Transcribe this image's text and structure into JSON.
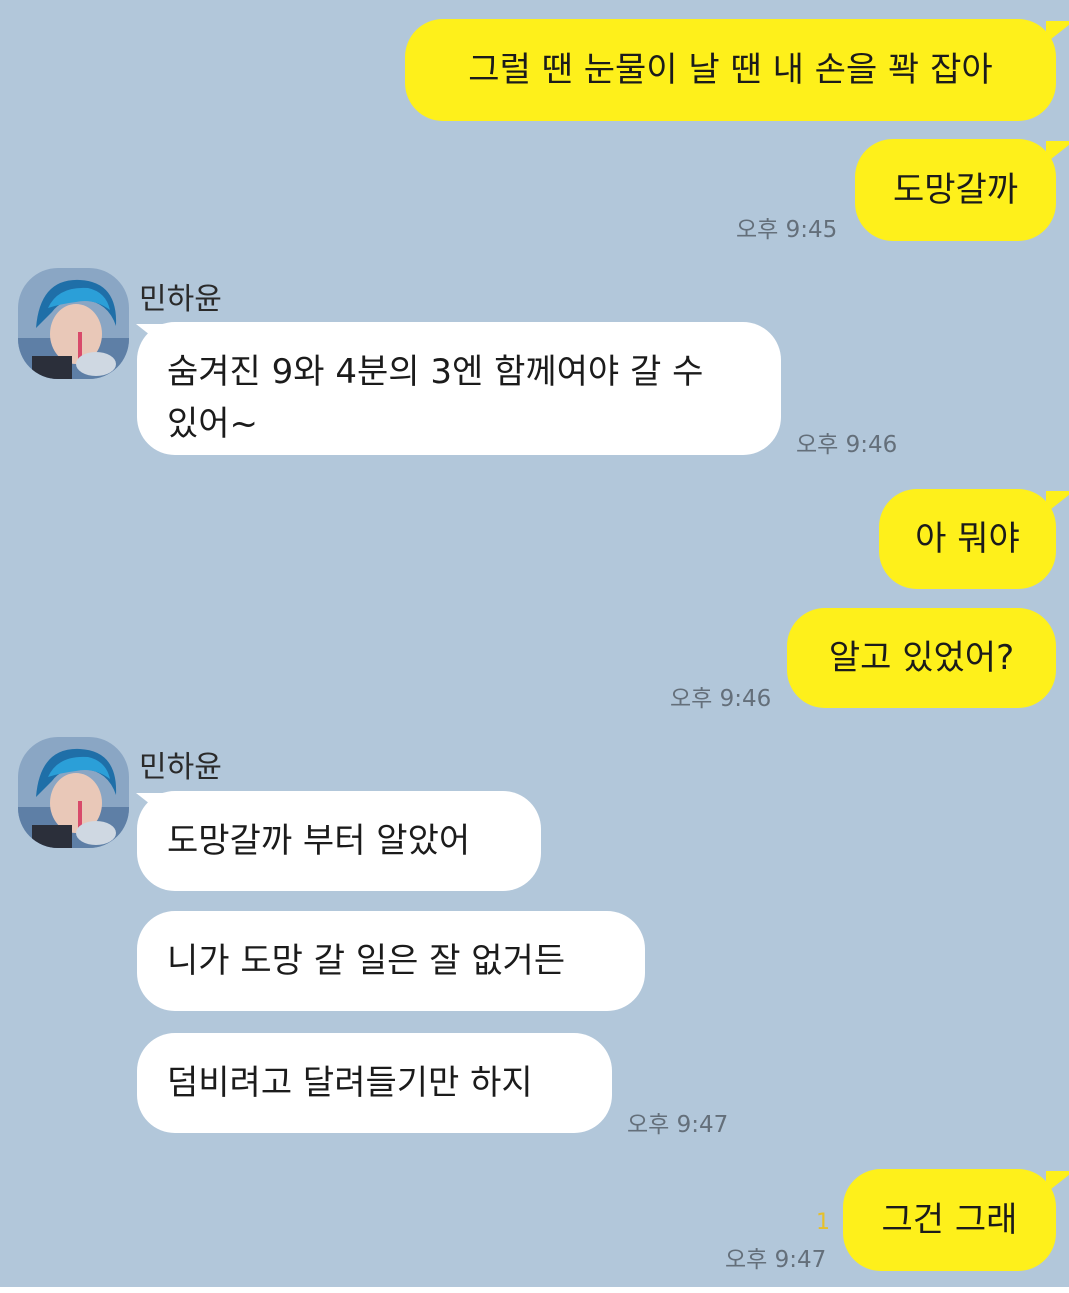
{
  "chat": {
    "sender_name": "민하윤",
    "messages": [
      {
        "text": "그럴 땐 눈물이 날 땐 내 손을 꽉 잡아"
      },
      {
        "text": "도망갈까",
        "time": "오후 9:45"
      },
      {
        "text": "숨겨진 9와 4분의 3엔 함께여야 갈 수 있어~",
        "time": "오후 9:46"
      },
      {
        "text": "아 뭐야"
      },
      {
        "text": "알고 있었어?",
        "time": "오후 9:46"
      },
      {
        "text": "도망갈까 부터 알았어"
      },
      {
        "text": "니가 도망 갈 일은 잘 없거든"
      },
      {
        "text": "덤비려고 달려들기만 하지",
        "time": "오후 9:47"
      },
      {
        "text": "그건 그래",
        "time": "오후 9:47",
        "unread_count": "1"
      }
    ]
  },
  "colors": {
    "chat_background": "#b2c7da",
    "my_bubble": "#fef01b",
    "other_bubble": "#ffffff",
    "unread_count": "#e6c02b"
  }
}
